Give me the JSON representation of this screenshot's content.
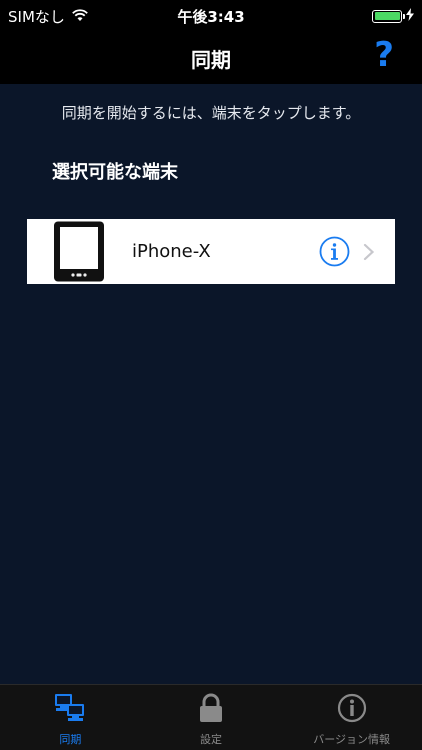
{
  "status_bar": {
    "carrier": "SIMなし",
    "time": "午後3:43",
    "icons": [
      "wifi-icon",
      "battery-icon",
      "charging-bolt-icon"
    ]
  },
  "nav": {
    "title": "同期",
    "help_label": "?"
  },
  "main": {
    "instruction": "同期を開始するには、端末をタップします。",
    "section_title": "選択可能な端末",
    "devices": [
      {
        "name": "iPhone-X",
        "icon": "tablet-icon"
      }
    ]
  },
  "tabs": [
    {
      "label": "同期",
      "icon": "sync-computers-icon",
      "active": true
    },
    {
      "label": "設定",
      "icon": "lock-icon",
      "active": false
    },
    {
      "label": "バージョン情報",
      "icon": "info-icon",
      "active": false
    }
  ],
  "colors": {
    "background": "#0b1629",
    "accent": "#1a7cf0",
    "battery": "#4cd964"
  }
}
